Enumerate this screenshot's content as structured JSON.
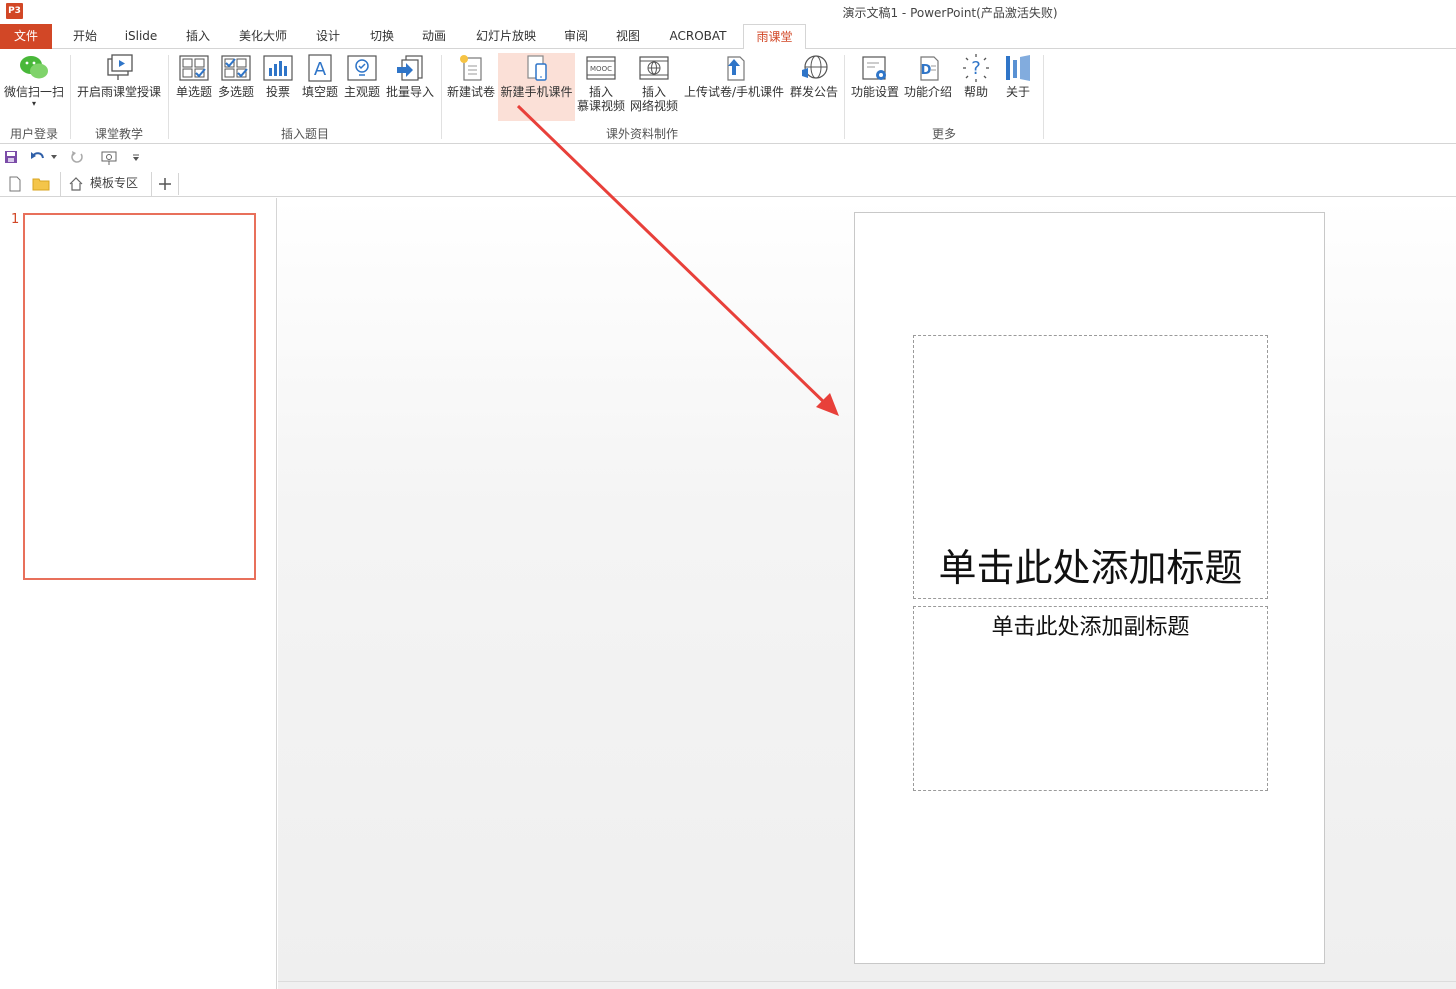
{
  "titlebar": {
    "app_logo": "P3",
    "title": "演示文稿1 - PowerPoint(产品激活失败)"
  },
  "tabs": [
    {
      "label": "文件"
    },
    {
      "label": "开始"
    },
    {
      "label": "iSlide"
    },
    {
      "label": "插入"
    },
    {
      "label": "美化大师"
    },
    {
      "label": "设计"
    },
    {
      "label": "切换"
    },
    {
      "label": "动画"
    },
    {
      "label": "幻灯片放映"
    },
    {
      "label": "审阅"
    },
    {
      "label": "视图"
    },
    {
      "label": "ACROBAT"
    },
    {
      "label": "雨课堂"
    }
  ],
  "ribbon": {
    "groups": {
      "user_login": "用户登录",
      "class_teaching": "课堂教学",
      "insert_question": "插入题目",
      "extra_material": "课外资料制作",
      "more": "更多"
    },
    "buttons": {
      "wechat_scan": "微信扫一扫",
      "start_class": "开启雨课堂授课",
      "single_choice": "单选题",
      "multi_choice": "多选题",
      "vote": "投票",
      "fill_blank": "填空题",
      "subjective": "主观题",
      "batch_import": "批量导入",
      "new_exam": "新建试卷",
      "new_mobile_courseware": "新建手机课件",
      "insert_mooc_1": "插入",
      "insert_mooc_2": "慕课视频",
      "insert_web_1": "插入",
      "insert_web_2": "网络视频",
      "upload": "上传试卷/手机课件",
      "announce": "群发公告",
      "settings": "功能设置",
      "intro": "功能介绍",
      "help": "帮助",
      "about": "关于"
    },
    "mooc_icon_text": "MOOC"
  },
  "docbar": {
    "tab_label": "模板专区"
  },
  "thumbnails": {
    "slide_number": "1"
  },
  "slide": {
    "title_placeholder": "单击此处添加标题",
    "subtitle_placeholder": "单击此处添加副标题"
  },
  "colors": {
    "accent": "#d24726",
    "highlight": "#fbe0d7",
    "thumb_border": "#e8705b",
    "arrow": "#e8403a"
  }
}
